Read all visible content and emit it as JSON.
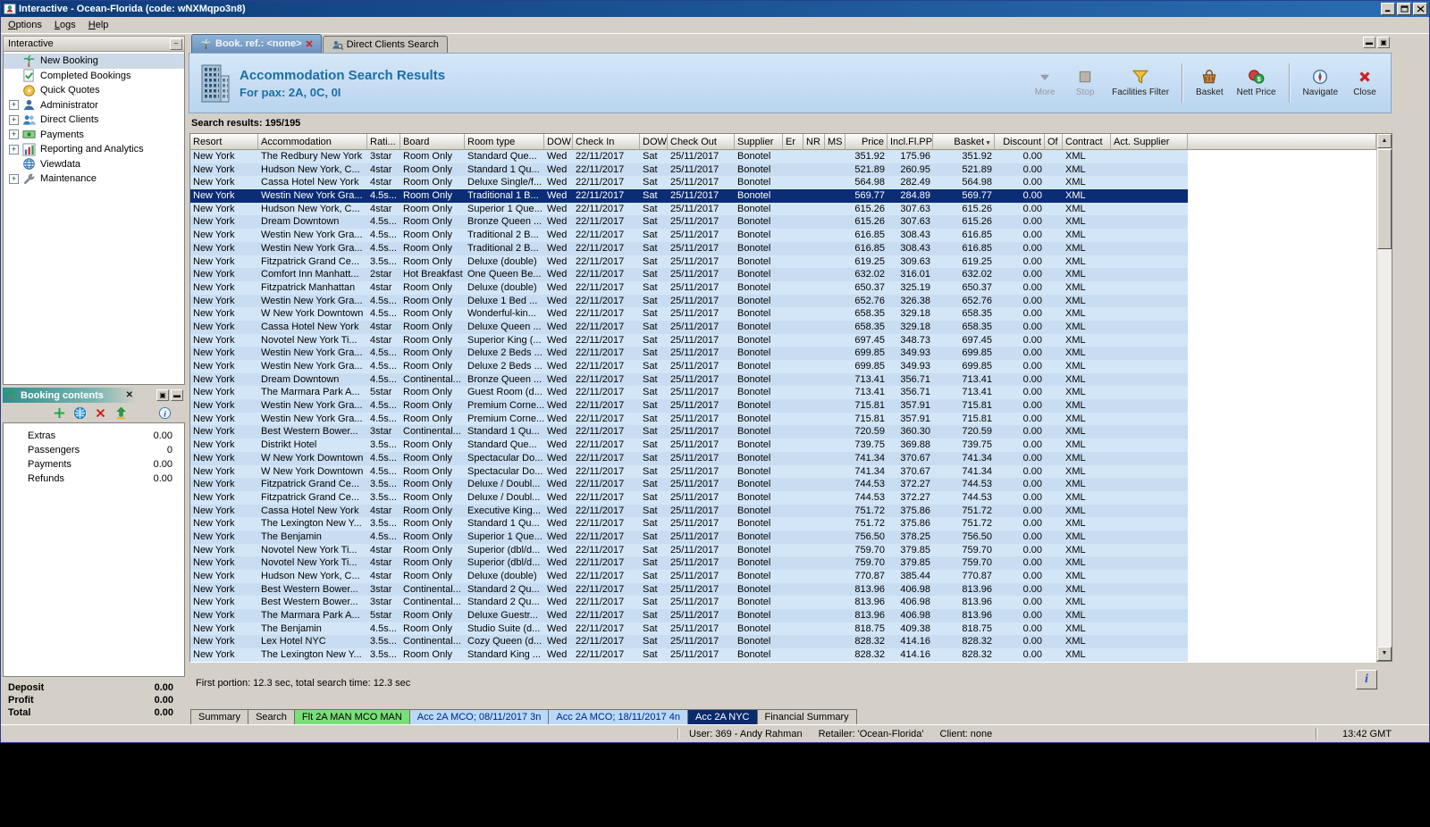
{
  "window": {
    "title": "Interactive - Ocean-Florida (code: wNXMqpo3n8)",
    "time": "13:42 GMT",
    "status_user": "User: 369 - Andy Rahman",
    "status_retailer": "Retailer: 'Ocean-Florida'",
    "status_client": "Client: none"
  },
  "menu": {
    "items": [
      "Options",
      "Logs",
      "Help"
    ]
  },
  "sidebar": {
    "title": "Interactive",
    "items": [
      {
        "label": "New Booking",
        "icon": "palm-icon",
        "expandable": false,
        "selected": true
      },
      {
        "label": "Completed Bookings",
        "icon": "completed-bookings-icon",
        "expandable": false,
        "selected": false
      },
      {
        "label": "Quick Quotes",
        "icon": "quick-quotes-icon",
        "expandable": false,
        "selected": false
      },
      {
        "label": "Administrator",
        "icon": "administrator-icon",
        "expandable": true,
        "selected": false
      },
      {
        "label": "Direct Clients",
        "icon": "direct-clients-icon",
        "expandable": true,
        "selected": false
      },
      {
        "label": "Payments",
        "icon": "payments-icon",
        "expandable": true,
        "selected": false
      },
      {
        "label": "Reporting and Analytics",
        "icon": "reporting-icon",
        "expandable": true,
        "selected": false
      },
      {
        "label": "Viewdata",
        "icon": "viewdata-icon",
        "expandable": false,
        "selected": false
      },
      {
        "label": "Maintenance",
        "icon": "maintenance-icon",
        "expandable": true,
        "selected": false
      }
    ]
  },
  "booking_contents": {
    "title": "Booking contents",
    "rows": [
      {
        "label": "Extras",
        "value": "0.00"
      },
      {
        "label": "Passengers",
        "value": "0"
      },
      {
        "label": "Payments",
        "value": "0.00"
      },
      {
        "label": "Refunds",
        "value": "0.00"
      }
    ],
    "totals": [
      {
        "label": "Deposit",
        "value": "0.00"
      },
      {
        "label": "Profit",
        "value": "0.00"
      },
      {
        "label": "Total",
        "value": "0.00"
      }
    ]
  },
  "tabs": {
    "booking": {
      "label": "Book. ref.: <none>"
    },
    "direct": {
      "label": "Direct Clients Search"
    }
  },
  "header": {
    "title": "Accommodation Search Results",
    "subtitle": "For pax: 2A, 0C, 0I",
    "buttons": [
      {
        "label": "More",
        "icon": "more-icon",
        "enabled": false,
        "sep_before": false
      },
      {
        "label": "Stop",
        "icon": "stop-icon",
        "enabled": false,
        "sep_before": false
      },
      {
        "label": "Facilities Filter",
        "icon": "filter-icon",
        "enabled": true,
        "sep_before": false
      },
      {
        "label": "Basket",
        "icon": "basket-icon",
        "enabled": true,
        "sep_before": true
      },
      {
        "label": "Nett Price",
        "icon": "nett-price-icon",
        "enabled": true,
        "sep_before": false
      },
      {
        "label": "Navigate",
        "icon": "navigate-icon",
        "enabled": true,
        "sep_before": true
      },
      {
        "label": "Close",
        "icon": "close-red-icon",
        "enabled": true,
        "sep_before": false
      }
    ]
  },
  "results": {
    "label": "Search results: 195/195",
    "timing": "First portion: 12.3 sec, total search time: 12.3 sec",
    "columns": [
      "Resort",
      "Accommodation",
      "Rati...",
      "Board",
      "Room type",
      "DOW",
      "Check In",
      "DOW",
      "Check Out",
      "Supplier",
      "Er",
      "NR",
      "MS",
      "Price",
      "Incl.Fl.PP",
      "Basket",
      "Discount",
      "Of",
      "Contract",
      "Act. Supplier"
    ],
    "selected_index": 3,
    "rows": [
      [
        "New York",
        "The Redbury New York",
        "3star",
        "Room Only",
        "Standard Que...",
        "Wed",
        "22/11/2017",
        "Sat",
        "25/11/2017",
        "Bonotel",
        "",
        "",
        "",
        "351.92",
        "175.96",
        "351.92",
        "0.00",
        "",
        "XML",
        ""
      ],
      [
        "New York",
        "Hudson New York, C...",
        "4star",
        "Room Only",
        "Standard 1 Qu...",
        "Wed",
        "22/11/2017",
        "Sat",
        "25/11/2017",
        "Bonotel",
        "",
        "",
        "",
        "521.89",
        "260.95",
        "521.89",
        "0.00",
        "",
        "XML",
        ""
      ],
      [
        "New York",
        "Cassa Hotel New York",
        "4star",
        "Room Only",
        "Deluxe Single/f...",
        "Wed",
        "22/11/2017",
        "Sat",
        "25/11/2017",
        "Bonotel",
        "",
        "",
        "",
        "564.98",
        "282.49",
        "564.98",
        "0.00",
        "",
        "XML",
        ""
      ],
      [
        "New York",
        "Westin New York Gra...",
        "4.5s...",
        "Room Only",
        "Traditional 1 B...",
        "Wed",
        "22/11/2017",
        "Sat",
        "25/11/2017",
        "Bonotel",
        "",
        "",
        "",
        "569.77",
        "284.89",
        "569.77",
        "0.00",
        "",
        "XML",
        ""
      ],
      [
        "New York",
        "Hudson New York, C...",
        "4star",
        "Room Only",
        "Superior 1 Que...",
        "Wed",
        "22/11/2017",
        "Sat",
        "25/11/2017",
        "Bonotel",
        "",
        "",
        "",
        "615.26",
        "307.63",
        "615.26",
        "0.00",
        "",
        "XML",
        ""
      ],
      [
        "New York",
        "Dream Downtown",
        "4.5s...",
        "Room Only",
        "Bronze Queen ...",
        "Wed",
        "22/11/2017",
        "Sat",
        "25/11/2017",
        "Bonotel",
        "",
        "",
        "",
        "615.26",
        "307.63",
        "615.26",
        "0.00",
        "",
        "XML",
        ""
      ],
      [
        "New York",
        "Westin New York Gra...",
        "4.5s...",
        "Room Only",
        "Traditional 2 B...",
        "Wed",
        "22/11/2017",
        "Sat",
        "25/11/2017",
        "Bonotel",
        "",
        "",
        "",
        "616.85",
        "308.43",
        "616.85",
        "0.00",
        "",
        "XML",
        ""
      ],
      [
        "New York",
        "Westin New York Gra...",
        "4.5s...",
        "Room Only",
        "Traditional 2 B...",
        "Wed",
        "22/11/2017",
        "Sat",
        "25/11/2017",
        "Bonotel",
        "",
        "",
        "",
        "616.85",
        "308.43",
        "616.85",
        "0.00",
        "",
        "XML",
        ""
      ],
      [
        "New York",
        "Fitzpatrick Grand Ce...",
        "3.5s...",
        "Room Only",
        "Deluxe (double)",
        "Wed",
        "22/11/2017",
        "Sat",
        "25/11/2017",
        "Bonotel",
        "",
        "",
        "",
        "619.25",
        "309.63",
        "619.25",
        "0.00",
        "",
        "XML",
        ""
      ],
      [
        "New York",
        "Comfort Inn Manhatt...",
        "2star",
        "Hot Breakfast",
        "One Queen Be...",
        "Wed",
        "22/11/2017",
        "Sat",
        "25/11/2017",
        "Bonotel",
        "",
        "",
        "",
        "632.02",
        "316.01",
        "632.02",
        "0.00",
        "",
        "XML",
        ""
      ],
      [
        "New York",
        "Fitzpatrick Manhattan",
        "4star",
        "Room Only",
        "Deluxe (double)",
        "Wed",
        "22/11/2017",
        "Sat",
        "25/11/2017",
        "Bonotel",
        "",
        "",
        "",
        "650.37",
        "325.19",
        "650.37",
        "0.00",
        "",
        "XML",
        ""
      ],
      [
        "New York",
        "Westin New York Gra...",
        "4.5s...",
        "Room Only",
        "Deluxe 1 Bed ...",
        "Wed",
        "22/11/2017",
        "Sat",
        "25/11/2017",
        "Bonotel",
        "",
        "",
        "",
        "652.76",
        "326.38",
        "652.76",
        "0.00",
        "",
        "XML",
        ""
      ],
      [
        "New York",
        "W New York Downtown",
        "4.5s...",
        "Room Only",
        "Wonderful-kin...",
        "Wed",
        "22/11/2017",
        "Sat",
        "25/11/2017",
        "Bonotel",
        "",
        "",
        "",
        "658.35",
        "329.18",
        "658.35",
        "0.00",
        "",
        "XML",
        ""
      ],
      [
        "New York",
        "Cassa Hotel New York",
        "4star",
        "Room Only",
        "Deluxe Queen ...",
        "Wed",
        "22/11/2017",
        "Sat",
        "25/11/2017",
        "Bonotel",
        "",
        "",
        "",
        "658.35",
        "329.18",
        "658.35",
        "0.00",
        "",
        "XML",
        ""
      ],
      [
        "New York",
        "Novotel New York Ti...",
        "4star",
        "Room Only",
        "Superior King (...",
        "Wed",
        "22/11/2017",
        "Sat",
        "25/11/2017",
        "Bonotel",
        "",
        "",
        "",
        "697.45",
        "348.73",
        "697.45",
        "0.00",
        "",
        "XML",
        ""
      ],
      [
        "New York",
        "Westin New York Gra...",
        "4.5s...",
        "Room Only",
        "Deluxe 2 Beds ...",
        "Wed",
        "22/11/2017",
        "Sat",
        "25/11/2017",
        "Bonotel",
        "",
        "",
        "",
        "699.85",
        "349.93",
        "699.85",
        "0.00",
        "",
        "XML",
        ""
      ],
      [
        "New York",
        "Westin New York Gra...",
        "4.5s...",
        "Room Only",
        "Deluxe 2 Beds ...",
        "Wed",
        "22/11/2017",
        "Sat",
        "25/11/2017",
        "Bonotel",
        "",
        "",
        "",
        "699.85",
        "349.93",
        "699.85",
        "0.00",
        "",
        "XML",
        ""
      ],
      [
        "New York",
        "Dream Downtown",
        "4.5s...",
        "Continental...",
        "Bronze Queen ...",
        "Wed",
        "22/11/2017",
        "Sat",
        "25/11/2017",
        "Bonotel",
        "",
        "",
        "",
        "713.41",
        "356.71",
        "713.41",
        "0.00",
        "",
        "XML",
        ""
      ],
      [
        "New York",
        "The Marmara Park A...",
        "5star",
        "Room Only",
        "Guest Room (d...",
        "Wed",
        "22/11/2017",
        "Sat",
        "25/11/2017",
        "Bonotel",
        "",
        "",
        "",
        "713.41",
        "356.71",
        "713.41",
        "0.00",
        "",
        "XML",
        ""
      ],
      [
        "New York",
        "Westin New York Gra...",
        "4.5s...",
        "Room Only",
        "Premium Corne...",
        "Wed",
        "22/11/2017",
        "Sat",
        "25/11/2017",
        "Bonotel",
        "",
        "",
        "",
        "715.81",
        "357.91",
        "715.81",
        "0.00",
        "",
        "XML",
        ""
      ],
      [
        "New York",
        "Westin New York Gra...",
        "4.5s...",
        "Room Only",
        "Premium Corne...",
        "Wed",
        "22/11/2017",
        "Sat",
        "25/11/2017",
        "Bonotel",
        "",
        "",
        "",
        "715.81",
        "357.91",
        "715.81",
        "0.00",
        "",
        "XML",
        ""
      ],
      [
        "New York",
        "Best Western Bower...",
        "3star",
        "Continental...",
        "Standard 1 Qu...",
        "Wed",
        "22/11/2017",
        "Sat",
        "25/11/2017",
        "Bonotel",
        "",
        "",
        "",
        "720.59",
        "360.30",
        "720.59",
        "0.00",
        "",
        "XML",
        ""
      ],
      [
        "New York",
        "Distrikt Hotel",
        "3.5s...",
        "Room Only",
        "Standard Que...",
        "Wed",
        "22/11/2017",
        "Sat",
        "25/11/2017",
        "Bonotel",
        "",
        "",
        "",
        "739.75",
        "369.88",
        "739.75",
        "0.00",
        "",
        "XML",
        ""
      ],
      [
        "New York",
        "W New York Downtown",
        "4.5s...",
        "Room Only",
        "Spectacular Do...",
        "Wed",
        "22/11/2017",
        "Sat",
        "25/11/2017",
        "Bonotel",
        "",
        "",
        "",
        "741.34",
        "370.67",
        "741.34",
        "0.00",
        "",
        "XML",
        ""
      ],
      [
        "New York",
        "W New York Downtown",
        "4.5s...",
        "Room Only",
        "Spectacular Do...",
        "Wed",
        "22/11/2017",
        "Sat",
        "25/11/2017",
        "Bonotel",
        "",
        "",
        "",
        "741.34",
        "370.67",
        "741.34",
        "0.00",
        "",
        "XML",
        ""
      ],
      [
        "New York",
        "Fitzpatrick Grand Ce...",
        "3.5s...",
        "Room Only",
        "Deluxe / Doubl...",
        "Wed",
        "22/11/2017",
        "Sat",
        "25/11/2017",
        "Bonotel",
        "",
        "",
        "",
        "744.53",
        "372.27",
        "744.53",
        "0.00",
        "",
        "XML",
        ""
      ],
      [
        "New York",
        "Fitzpatrick Grand Ce...",
        "3.5s...",
        "Room Only",
        "Deluxe / Doubl...",
        "Wed",
        "22/11/2017",
        "Sat",
        "25/11/2017",
        "Bonotel",
        "",
        "",
        "",
        "744.53",
        "372.27",
        "744.53",
        "0.00",
        "",
        "XML",
        ""
      ],
      [
        "New York",
        "Cassa Hotel New York",
        "4star",
        "Room Only",
        "Executive King...",
        "Wed",
        "22/11/2017",
        "Sat",
        "25/11/2017",
        "Bonotel",
        "",
        "",
        "",
        "751.72",
        "375.86",
        "751.72",
        "0.00",
        "",
        "XML",
        ""
      ],
      [
        "New York",
        "The Lexington New Y...",
        "3.5s...",
        "Room Only",
        "Standard 1 Qu...",
        "Wed",
        "22/11/2017",
        "Sat",
        "25/11/2017",
        "Bonotel",
        "",
        "",
        "",
        "751.72",
        "375.86",
        "751.72",
        "0.00",
        "",
        "XML",
        ""
      ],
      [
        "New York",
        "The Benjamin",
        "4.5s...",
        "Room Only",
        "Superior 1 Que...",
        "Wed",
        "22/11/2017",
        "Sat",
        "25/11/2017",
        "Bonotel",
        "",
        "",
        "",
        "756.50",
        "378.25",
        "756.50",
        "0.00",
        "",
        "XML",
        ""
      ],
      [
        "New York",
        "Novotel New York Ti...",
        "4star",
        "Room Only",
        "Superior (dbl/d...",
        "Wed",
        "22/11/2017",
        "Sat",
        "25/11/2017",
        "Bonotel",
        "",
        "",
        "",
        "759.70",
        "379.85",
        "759.70",
        "0.00",
        "",
        "XML",
        ""
      ],
      [
        "New York",
        "Novotel New York Ti...",
        "4star",
        "Room Only",
        "Superior (dbl/d...",
        "Wed",
        "22/11/2017",
        "Sat",
        "25/11/2017",
        "Bonotel",
        "",
        "",
        "",
        "759.70",
        "379.85",
        "759.70",
        "0.00",
        "",
        "XML",
        ""
      ],
      [
        "New York",
        "Hudson New York, C...",
        "4star",
        "Room Only",
        "Deluxe (double)",
        "Wed",
        "22/11/2017",
        "Sat",
        "25/11/2017",
        "Bonotel",
        "",
        "",
        "",
        "770.87",
        "385.44",
        "770.87",
        "0.00",
        "",
        "XML",
        ""
      ],
      [
        "New York",
        "Best Western Bower...",
        "3star",
        "Continental...",
        "Standard 2 Qu...",
        "Wed",
        "22/11/2017",
        "Sat",
        "25/11/2017",
        "Bonotel",
        "",
        "",
        "",
        "813.96",
        "406.98",
        "813.96",
        "0.00",
        "",
        "XML",
        ""
      ],
      [
        "New York",
        "Best Western Bower...",
        "3star",
        "Continental...",
        "Standard 2 Qu...",
        "Wed",
        "22/11/2017",
        "Sat",
        "25/11/2017",
        "Bonotel",
        "",
        "",
        "",
        "813.96",
        "406.98",
        "813.96",
        "0.00",
        "",
        "XML",
        ""
      ],
      [
        "New York",
        "The Marmara Park A...",
        "5star",
        "Room Only",
        "Deluxe Guestr...",
        "Wed",
        "22/11/2017",
        "Sat",
        "25/11/2017",
        "Bonotel",
        "",
        "",
        "",
        "813.96",
        "406.98",
        "813.96",
        "0.00",
        "",
        "XML",
        ""
      ],
      [
        "New York",
        "The Benjamin",
        "4.5s...",
        "Room Only",
        "Studio Suite (d...",
        "Wed",
        "22/11/2017",
        "Sat",
        "25/11/2017",
        "Bonotel",
        "",
        "",
        "",
        "818.75",
        "409.38",
        "818.75",
        "0.00",
        "",
        "XML",
        ""
      ],
      [
        "New York",
        "Lex Hotel NYC",
        "3.5s...",
        "Continental...",
        "Cozy Queen (d...",
        "Wed",
        "22/11/2017",
        "Sat",
        "25/11/2017",
        "Bonotel",
        "",
        "",
        "",
        "828.32",
        "414.16",
        "828.32",
        "0.00",
        "",
        "XML",
        ""
      ],
      [
        "New York",
        "The Lexington New Y...",
        "3.5s...",
        "Room Only",
        "Standard King ...",
        "Wed",
        "22/11/2017",
        "Sat",
        "25/11/2017",
        "Bonotel",
        "",
        "",
        "",
        "828.32",
        "414.16",
        "828.32",
        "0.00",
        "",
        "XML",
        ""
      ]
    ]
  },
  "bottom_tabs": [
    {
      "label": "Summary",
      "style": "plain"
    },
    {
      "label": "Search",
      "style": "plain"
    },
    {
      "label": "Flt 2A MAN MCO MAN",
      "style": "flight"
    },
    {
      "label": "Acc 2A MCO; 08/11/2017 3n",
      "style": "acc"
    },
    {
      "label": "Acc 2A MCO; 18/11/2017 4n",
      "style": "acc"
    },
    {
      "label": "Acc 2A NYC",
      "style": "active"
    },
    {
      "label": "Financial Summary",
      "style": "plain"
    }
  ]
}
